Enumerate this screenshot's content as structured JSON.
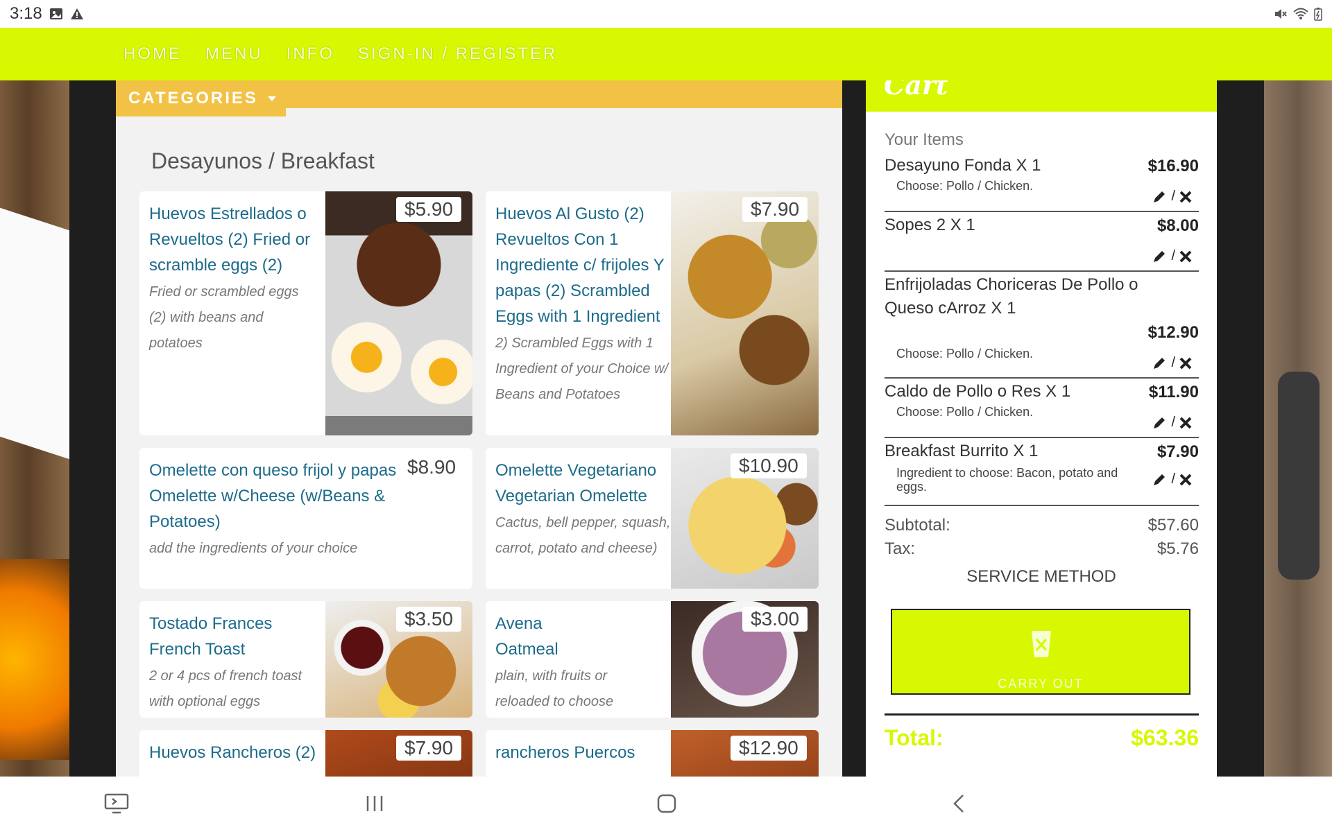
{
  "status_bar": {
    "time": "3:18"
  },
  "nav": {
    "items": [
      "HOME",
      "MENU",
      "INFO",
      "SIGN-IN / REGISTER"
    ]
  },
  "categories": {
    "label": "CATEGORIES"
  },
  "section": {
    "title": "Desayunos / Breakfast"
  },
  "menu_items": [
    {
      "name": "Huevos Estrellados o Revueltos (2) Fried or scramble eggs (2)",
      "desc": "Fried or scrambled eggs (2) with beans and potatoes",
      "price": "$5.90"
    },
    {
      "name": "Huevos Al Gusto (2) Revueltos Con 1 Ingrediente c/ frijoles Y papas (2) Scrambled Eggs with 1 Ingredient",
      "desc": "2) Scrambled Eggs with 1 Ingredient of your Choice w/ Beans and Potatoes",
      "price": "$7.90"
    },
    {
      "name": "Omelette con queso frijol y papas Omelette w/Cheese (w/Beans & Potatoes)",
      "desc": "add the ingredients of your choice",
      "price": "$8.90"
    },
    {
      "name": "Omelette Vegetariano Vegetarian Omelette",
      "desc": "Cactus, bell pepper, squash, carrot, potato and cheese)",
      "price": "$10.90"
    },
    {
      "name": "Tostado Frances French Toast",
      "desc": "2 or 4 pcs of french toast with optional eggs",
      "price": "$3.50"
    },
    {
      "name": "Avena Oatmeal",
      "desc": "plain, with fruits or reloaded to choose",
      "price": "$3.00"
    },
    {
      "name": "Huevos Rancheros (2)",
      "desc": "",
      "price": "$7.90"
    },
    {
      "name": "rancheros Puercos",
      "desc": "",
      "price": "$12.90"
    }
  ],
  "cart": {
    "title": "Cart",
    "your_items": "Your Items",
    "items": [
      {
        "name": "Desayuno Fonda X 1",
        "price": "$16.90",
        "note": "Choose: Pollo / Chicken."
      },
      {
        "name": "Sopes 2 X 1",
        "price": "$8.00",
        "note": ""
      },
      {
        "name": "Enfrijoladas Choriceras De Pollo o Queso cArroz X 1",
        "price": "$12.90",
        "note": "Choose: Pollo / Chicken."
      },
      {
        "name": "Caldo de Pollo o Res X 1",
        "price": "$11.90",
        "note": "Choose: Pollo / Chicken."
      },
      {
        "name": "Breakfast Burrito X 1",
        "price": "$7.90",
        "note": "Ingredient to choose: Bacon, potato and eggs."
      }
    ],
    "action_sep": "/",
    "subtotal_label": "Subtotal:",
    "subtotal": "$57.60",
    "tax_label": "Tax:",
    "tax": "$5.76",
    "service_method": "SERVICE METHOD",
    "carry_out": "CARRY OUT",
    "total_label": "Total:",
    "total": "$63.36"
  },
  "colors": {
    "accent": "#d7f800",
    "category": "#f2c246",
    "link": "#1c6b8a"
  }
}
